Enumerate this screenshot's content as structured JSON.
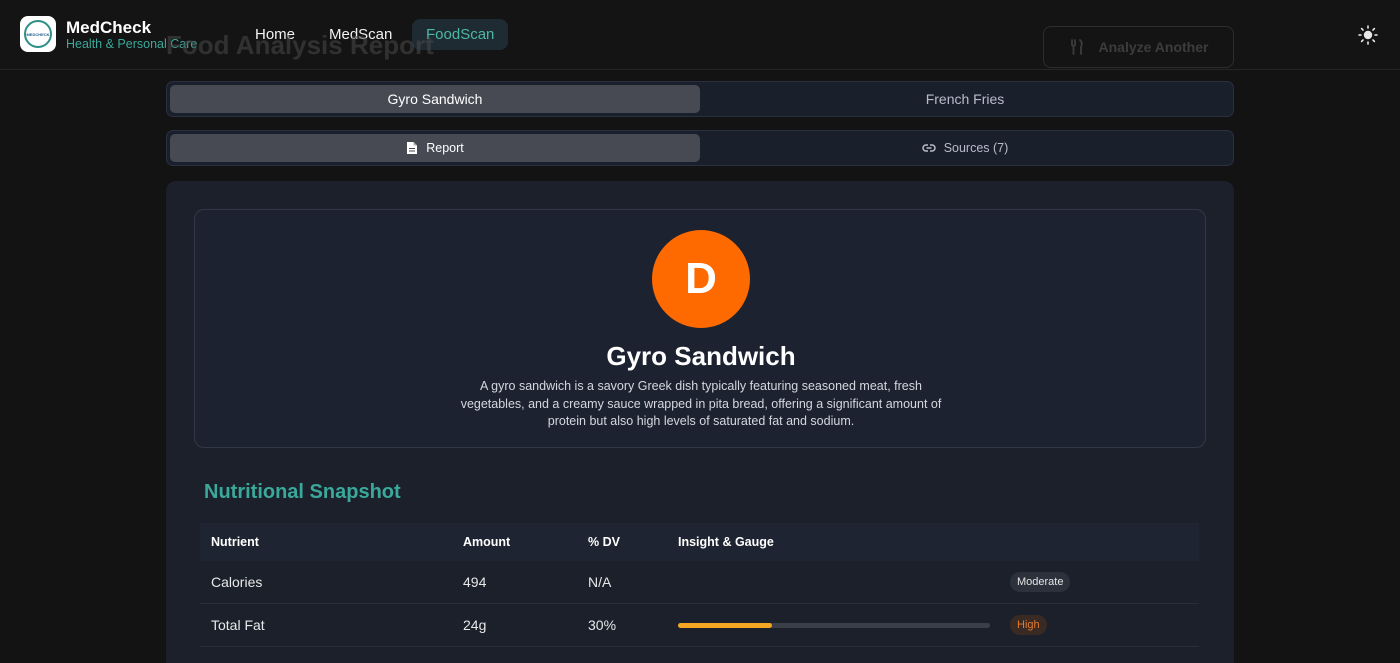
{
  "nav": {
    "brand": "MedCheck",
    "tagline": "Health & Personal Care",
    "logo_text": "MEDCHECK",
    "links": [
      {
        "label": "Home",
        "active": false
      },
      {
        "label": "MedScan",
        "active": false
      },
      {
        "label": "FoodScan",
        "active": true
      }
    ],
    "theme_icon": "sun-icon"
  },
  "header": {
    "title": "Food Analysis Report",
    "analyze_button": "Analyze Another",
    "analyze_icon": "utensils-icon"
  },
  "food_tabs": [
    {
      "label": "Gyro Sandwich",
      "active": true
    },
    {
      "label": "French Fries",
      "active": false
    }
  ],
  "view_tabs": [
    {
      "label": "Report",
      "icon": "document-icon",
      "active": true
    },
    {
      "label": "Sources (7)",
      "icon": "link-icon",
      "active": false
    }
  ],
  "report": {
    "grade": "D",
    "grade_color": "#ff6a00",
    "name": "Gyro Sandwich",
    "description": "A gyro sandwich is a savory Greek dish typically featuring seasoned meat, fresh vegetables, and a creamy sauce wrapped in pita bread, offering a significant amount of protein but also high levels of saturated fat and sodium.",
    "section_title": "Nutritional Snapshot",
    "columns": [
      "Nutrient",
      "Amount",
      "% DV",
      "Insight & Gauge"
    ],
    "rows": [
      {
        "nutrient": "Calories",
        "amount": "494",
        "dv": "N/A",
        "gauge": null,
        "level": "Moderate"
      },
      {
        "nutrient": "Total Fat",
        "amount": "24g",
        "dv": "30%",
        "gauge": 0.3,
        "level": "High"
      }
    ]
  },
  "colors": {
    "accent": "#3aa89a",
    "gauge": "#f5a623",
    "high": "#e07b30"
  }
}
